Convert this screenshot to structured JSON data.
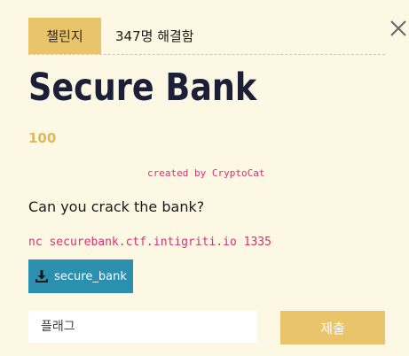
{
  "tabs": {
    "challenge_label": "챌린지",
    "solves_label": "347명 해결함"
  },
  "challenge": {
    "name": "Secure Bank",
    "points": "100",
    "author": "created by CryptoCat",
    "description": "Can you crack the bank?",
    "connection": "nc securebank.ctf.intigriti.io 1335",
    "download_label": "secure_bank"
  },
  "flag_form": {
    "placeholder": "플래그",
    "submit_label": "제출"
  },
  "icons": {
    "close": "close-icon",
    "download": "download-icon"
  },
  "colors": {
    "background": "#fdf8e3",
    "accent": "#e9c46a",
    "title": "#1b1f38",
    "code": "#d6336c",
    "download_button": "#2b8fb0"
  }
}
